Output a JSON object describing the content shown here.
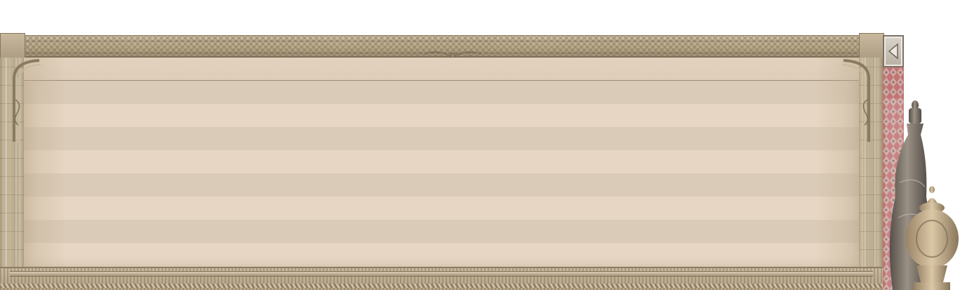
{
  "panel": {
    "header_text": "",
    "row_count": 8
  },
  "controls": {
    "collapse_button_icon": "triangle-left-icon"
  },
  "theme": {
    "frame_color": "#b8a888",
    "panel_light": "#e6d6c3",
    "panel_dark": "#dacbb8",
    "carpet_color": "#9e2a2a",
    "vase_color": "#5b5148"
  }
}
